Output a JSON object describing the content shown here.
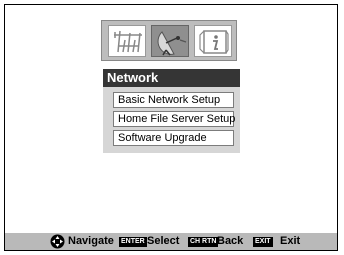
{
  "tabs": [
    {
      "icon": "antenna-icon",
      "active": false
    },
    {
      "icon": "satellite-dish-icon",
      "active": true
    },
    {
      "icon": "info-icon",
      "active": false
    }
  ],
  "panel": {
    "title": "Network",
    "items": [
      {
        "label": "Basic Network Setup"
      },
      {
        "label": "Home File Server Setup"
      },
      {
        "label": "Software Upgrade"
      }
    ]
  },
  "footer": {
    "navigate_label": "Navigate",
    "enter_key": "ENTER",
    "select_label": "Select",
    "chrtn_key": "CH RTN",
    "back_label": "Back",
    "exit_key": "EXIT",
    "exit_label": "Exit"
  },
  "colors": {
    "title_bar": "#353535",
    "menu_bg": "#d6d6d6",
    "footer_bg": "#b9b9b9",
    "active_tab": "#8f8f8f"
  }
}
